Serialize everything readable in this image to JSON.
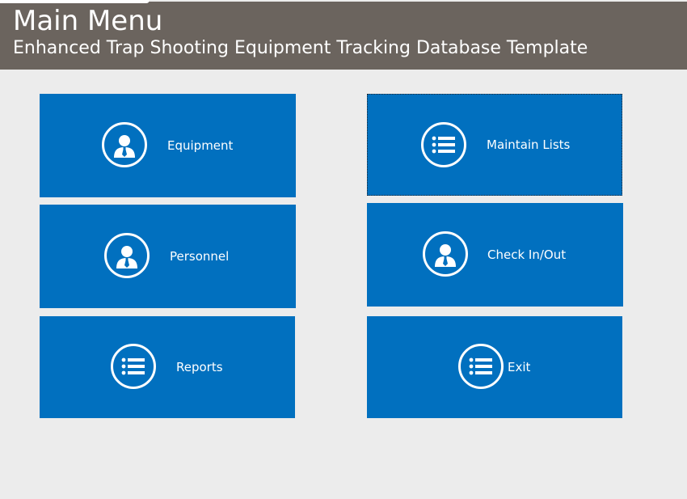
{
  "header": {
    "title": "Main Menu",
    "subtitle": "Enhanced Trap Shooting Equipment Tracking Database Template"
  },
  "tiles": {
    "equipment": {
      "label": "Equipment",
      "icon": "person-icon"
    },
    "maintain_lists": {
      "label": "Maintain Lists",
      "icon": "list-icon"
    },
    "personnel": {
      "label": "Personnel",
      "icon": "person-icon"
    },
    "check_in_out": {
      "label": "Check In/Out",
      "icon": "person-icon"
    },
    "reports": {
      "label": "Reports",
      "icon": "list-icon"
    },
    "exit": {
      "label": "Exit",
      "icon": "list-icon"
    }
  },
  "colors": {
    "header_bg": "#6b645e",
    "tile_bg": "#0170bf",
    "page_bg": "#ececec"
  }
}
